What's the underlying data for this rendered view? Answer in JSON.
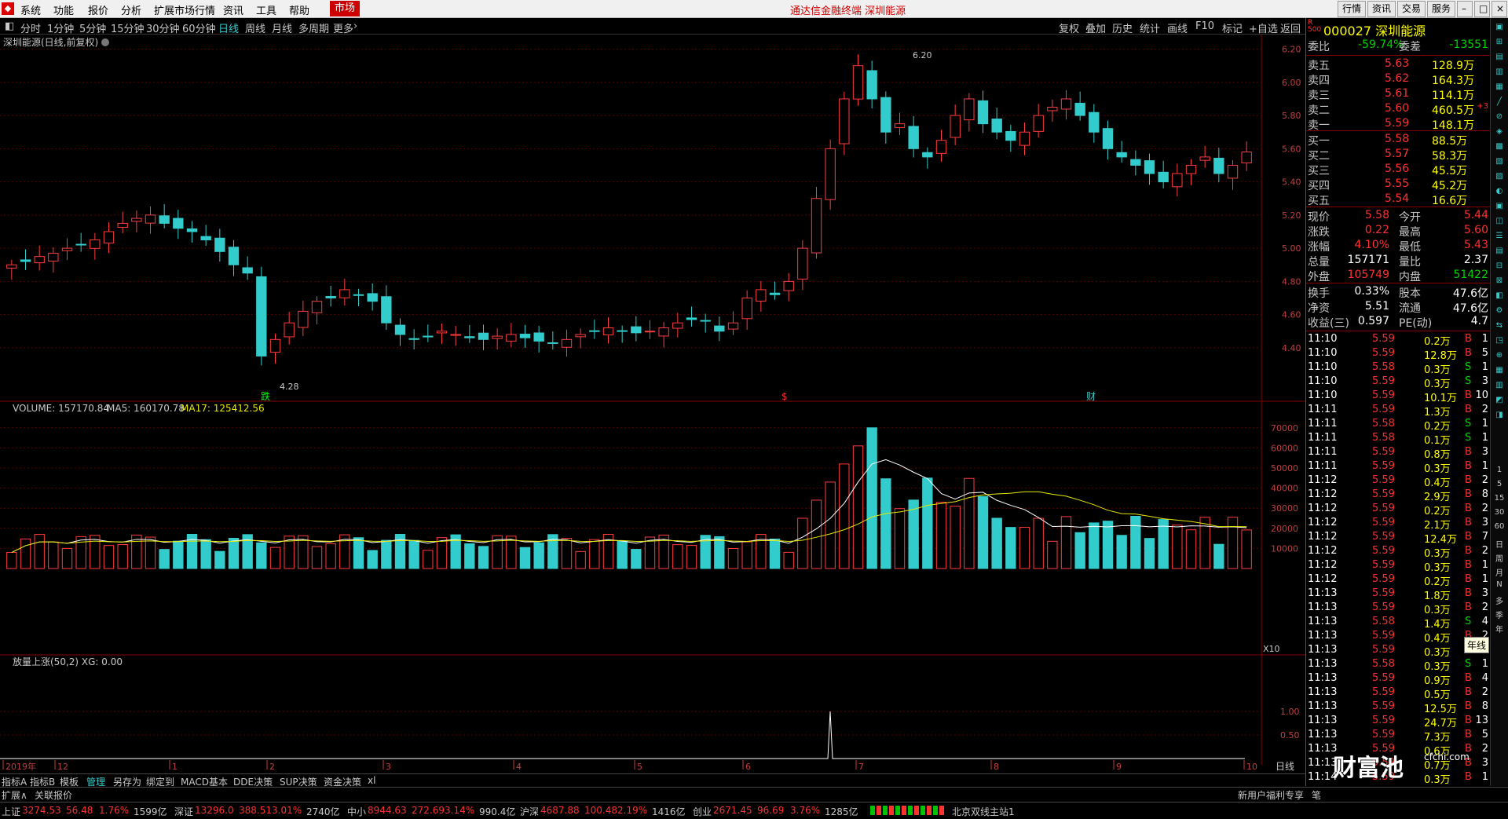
{
  "menu": {
    "items": [
      "系统",
      "功能",
      "报价",
      "分析",
      "扩展市场行情",
      "资讯",
      "工具",
      "帮助"
    ],
    "active": "市场",
    "app_title": "通达信金融终端  深圳能源",
    "right_buttons": [
      "行情",
      "资讯",
      "交易",
      "服务"
    ]
  },
  "periods": {
    "items": [
      "分时",
      "1分钟",
      "5分钟",
      "15分钟",
      "30分钟",
      "60分钟",
      "日线",
      "周线",
      "月线",
      "多周期",
      "更多"
    ],
    "selected": "日线",
    "tools": [
      "复权",
      "叠加",
      "历史",
      "统计",
      "画线",
      "F10",
      "标记",
      "+自选",
      "返回"
    ]
  },
  "main_chart": {
    "title": "深圳能源(日线,前复权)",
    "high_label": "6.20",
    "low_label": "4.28",
    "price_ticks": [
      "6.20",
      "6.00",
      "5.80",
      "5.60",
      "5.40",
      "5.20",
      "5.00",
      "4.80",
      "4.60",
      "4.40"
    ],
    "markers": [
      "跌",
      "$",
      "财"
    ],
    "colors": {
      "up": "#ff3c3c",
      "down": "#33cccc",
      "grid": "#5a0000",
      "ma_white": "#ffffff",
      "ma_yellow": "#e8e800"
    }
  },
  "volume_chart": {
    "legend_name": "VOLUME: 157170.84",
    "legend_ma5": "MA5: 160170.78",
    "legend_ma17": "MA17: 125412.56",
    "ticks": [
      "70000",
      "60000",
      "50000",
      "40000",
      "30000",
      "20000",
      "10000"
    ],
    "unit": "X10"
  },
  "indicator_chart": {
    "legend": "放量上涨(50,2)  XG: 0.00",
    "ticks": [
      "1.00",
      "0.50"
    ]
  },
  "date_axis": {
    "labels": [
      "2019年",
      "12",
      "1",
      "2",
      "3",
      "4",
      "5",
      "6",
      "7",
      "8",
      "9",
      "10"
    ],
    "period_label": "日线"
  },
  "bottom_tabs": [
    "指标A",
    "指标B",
    "模板",
    "管理",
    "另存为",
    "绑定到",
    "MACD基本",
    "DDE决策",
    "SUP决策",
    "资金决策",
    "xl"
  ],
  "bottom_tab_active": "管理",
  "status_left": [
    "扩展∧",
    "关联报价"
  ],
  "status_right": "新用户福利专享",
  "stock": {
    "header": "000027 深圳能源",
    "weibi_label": "委比",
    "weibi": "-59.74%",
    "weicha_label": "委差",
    "weicha": "-13551",
    "asks": [
      {
        "label": "卖五",
        "price": "5.63",
        "vol": "128.9万",
        "extra": ""
      },
      {
        "label": "卖四",
        "price": "5.62",
        "vol": "164.3万",
        "extra": ""
      },
      {
        "label": "卖三",
        "price": "5.61",
        "vol": "114.1万",
        "extra": ""
      },
      {
        "label": "卖二",
        "price": "5.60",
        "vol": "460.5万",
        "extra": "+3"
      },
      {
        "label": "卖一",
        "price": "5.59",
        "vol": "148.1万",
        "extra": ""
      }
    ],
    "bids": [
      {
        "label": "买一",
        "price": "5.58",
        "vol": "88.5万"
      },
      {
        "label": "买二",
        "price": "5.57",
        "vol": "58.3万"
      },
      {
        "label": "买三",
        "price": "5.56",
        "vol": "45.5万"
      },
      {
        "label": "买四",
        "price": "5.55",
        "vol": "45.2万"
      },
      {
        "label": "买五",
        "price": "5.54",
        "vol": "16.6万"
      }
    ],
    "quote": [
      {
        "l1": "现价",
        "v1": "5.58",
        "l2": "今开",
        "v2": "5.44"
      },
      {
        "l1": "涨跌",
        "v1": "0.22",
        "l2": "最高",
        "v2": "5.60"
      },
      {
        "l1": "涨幅",
        "v1": "4.10%",
        "l2": "最低",
        "v2": "5.43"
      },
      {
        "l1": "总量",
        "v1": "157171",
        "l2": "量比",
        "v2": "2.37"
      },
      {
        "l1": "外盘",
        "v1": "105749",
        "l2": "内盘",
        "v2": "51422"
      }
    ],
    "fund": [
      {
        "l1": "换手",
        "v1": "0.33%",
        "l2": "股本",
        "v2": "47.6亿"
      },
      {
        "l1": "净资",
        "v1": "5.51",
        "l2": "流通",
        "v2": "47.6亿"
      },
      {
        "l1": "收益(三)",
        "v1": "0.597",
        "l2": "PE(动)",
        "v2": "4.7"
      }
    ],
    "ticks": [
      {
        "t": "11:10",
        "p": "5.59",
        "v": "0.2万",
        "s": "B",
        "n": "1"
      },
      {
        "t": "11:10",
        "p": "5.59",
        "v": "12.8万",
        "s": "B",
        "n": "5"
      },
      {
        "t": "11:10",
        "p": "5.58",
        "v": "0.3万",
        "s": "S",
        "n": "1"
      },
      {
        "t": "11:10",
        "p": "5.59",
        "v": "0.3万",
        "s": "S",
        "n": "3"
      },
      {
        "t": "11:10",
        "p": "5.59",
        "v": "10.1万",
        "s": "B",
        "n": "10"
      },
      {
        "t": "11:11",
        "p": "5.59",
        "v": "1.3万",
        "s": "B",
        "n": "2"
      },
      {
        "t": "11:11",
        "p": "5.58",
        "v": "0.2万",
        "s": "S",
        "n": "1"
      },
      {
        "t": "11:11",
        "p": "5.58",
        "v": "0.1万",
        "s": "S",
        "n": "1"
      },
      {
        "t": "11:11",
        "p": "5.59",
        "v": "0.8万",
        "s": "B",
        "n": "3"
      },
      {
        "t": "11:11",
        "p": "5.59",
        "v": "0.3万",
        "s": "B",
        "n": "1"
      },
      {
        "t": "11:12",
        "p": "5.59",
        "v": "0.4万",
        "s": "B",
        "n": "2"
      },
      {
        "t": "11:12",
        "p": "5.59",
        "v": "2.9万",
        "s": "B",
        "n": "8"
      },
      {
        "t": "11:12",
        "p": "5.59",
        "v": "0.2万",
        "s": "B",
        "n": "2"
      },
      {
        "t": "11:12",
        "p": "5.59",
        "v": "2.1万",
        "s": "B",
        "n": "3"
      },
      {
        "t": "11:12",
        "p": "5.59",
        "v": "12.4万",
        "s": "B",
        "n": "7"
      },
      {
        "t": "11:12",
        "p": "5.59",
        "v": "0.3万",
        "s": "B",
        "n": "2"
      },
      {
        "t": "11:12",
        "p": "5.59",
        "v": "0.3万",
        "s": "B",
        "n": "1"
      },
      {
        "t": "11:12",
        "p": "5.59",
        "v": "0.2万",
        "s": "B",
        "n": "1"
      },
      {
        "t": "11:13",
        "p": "5.59",
        "v": "1.8万",
        "s": "B",
        "n": "3"
      },
      {
        "t": "11:13",
        "p": "5.59",
        "v": "0.3万",
        "s": "B",
        "n": "2"
      },
      {
        "t": "11:13",
        "p": "5.58",
        "v": "1.4万",
        "s": "S",
        "n": "4"
      },
      {
        "t": "11:13",
        "p": "5.59",
        "v": "0.4万",
        "s": "B",
        "n": "2"
      },
      {
        "t": "11:13",
        "p": "5.59",
        "v": "0.3万",
        "s": "B",
        "n": "2"
      },
      {
        "t": "11:13",
        "p": "5.58",
        "v": "0.3万",
        "s": "S",
        "n": "1"
      },
      {
        "t": "11:13",
        "p": "5.59",
        "v": "0.9万",
        "s": "B",
        "n": "4"
      },
      {
        "t": "11:13",
        "p": "5.59",
        "v": "0.5万",
        "s": "B",
        "n": "2"
      },
      {
        "t": "11:13",
        "p": "5.59",
        "v": "12.5万",
        "s": "B",
        "n": "8"
      },
      {
        "t": "11:13",
        "p": "5.59",
        "v": "24.7万",
        "s": "B",
        "n": "13"
      },
      {
        "t": "11:13",
        "p": "5.59",
        "v": "7.3万",
        "s": "B",
        "n": "5"
      },
      {
        "t": "11:13",
        "p": "5.59",
        "v": "0.6万",
        "s": "B",
        "n": "2"
      },
      {
        "t": "11:13",
        "p": "5.59",
        "v": "0.7万",
        "s": "B",
        "n": "3"
      },
      {
        "t": "11:14",
        "p": "5.59",
        "v": "0.3万",
        "s": "B",
        "n": "1"
      }
    ],
    "tab_label": "笔"
  },
  "right_tools": [
    "日",
    "周",
    "月",
    "N",
    "多",
    "季",
    "年"
  ],
  "right_tool_tooltip": "年线",
  "watermark": "财富池",
  "watermark_sub": "cfchi.com",
  "ticker": [
    {
      "name": "上证",
      "price": "3274.53",
      "chg": "56.48",
      "pct": "1.76%",
      "amt": "1599亿"
    },
    {
      "name": "深证",
      "price": "13296.0",
      "chg": "388.51",
      "pct": "3.01%",
      "amt": "2740亿"
    },
    {
      "name": "中小",
      "price": "8944.63",
      "chg": "272.69",
      "pct": "3.14%",
      "amt": "990.4亿"
    },
    {
      "name": "沪深",
      "price": "4687.88",
      "chg": "100.48",
      "pct": "2.19%",
      "amt": "1416亿"
    },
    {
      "name": "创业",
      "price": "2671.45",
      "chg": "96.69",
      "pct": "3.76%",
      "amt": "1285亿"
    }
  ],
  "server": "北京双线主站1",
  "chart_data": {
    "type": "candlestick",
    "title": "深圳能源(日线,前复权)",
    "y_range": [
      4.28,
      6.2
    ],
    "annotated_high": 6.2,
    "annotated_low": 4.28,
    "date_ticks": [
      "2019年",
      "12",
      "1",
      "2",
      "3",
      "4",
      "5",
      "6",
      "7",
      "8",
      "9",
      "10"
    ],
    "series": [
      {
        "name": "VOLUME",
        "last": 157170.84
      },
      {
        "name": "MA5",
        "last": 160170.78
      },
      {
        "name": "MA17",
        "last": 125412.56
      }
    ],
    "close_sample": [
      4.9,
      4.92,
      4.95,
      4.97,
      5.0,
      5.02,
      5.05,
      5.1,
      5.15,
      5.18,
      5.2,
      5.15,
      5.12,
      5.1,
      5.05,
      4.98,
      4.9,
      4.85,
      4.35,
      4.45,
      4.55,
      4.62,
      4.68,
      4.7,
      4.75,
      4.72,
      4.68,
      4.55,
      4.48,
      4.45,
      4.47,
      4.5,
      4.48,
      4.46,
      4.45,
      4.47,
      4.48,
      4.46,
      4.44,
      4.43,
      4.45,
      4.48,
      4.5,
      4.52,
      4.5,
      4.49,
      4.5,
      4.52,
      4.55,
      4.57,
      4.56,
      4.5,
      4.55,
      4.7,
      4.75,
      4.72,
      4.8,
      5.0,
      5.3,
      5.6,
      5.9,
      6.1,
      5.9,
      5.7,
      5.75,
      5.6,
      5.55,
      5.65,
      5.8,
      5.9,
      5.75,
      5.7,
      5.65,
      5.7,
      5.8,
      5.85,
      5.9,
      5.8,
      5.7,
      5.6,
      5.55,
      5.5,
      5.45,
      5.4,
      5.45,
      5.5,
      5.55,
      5.45,
      5.5,
      5.58
    ]
  }
}
